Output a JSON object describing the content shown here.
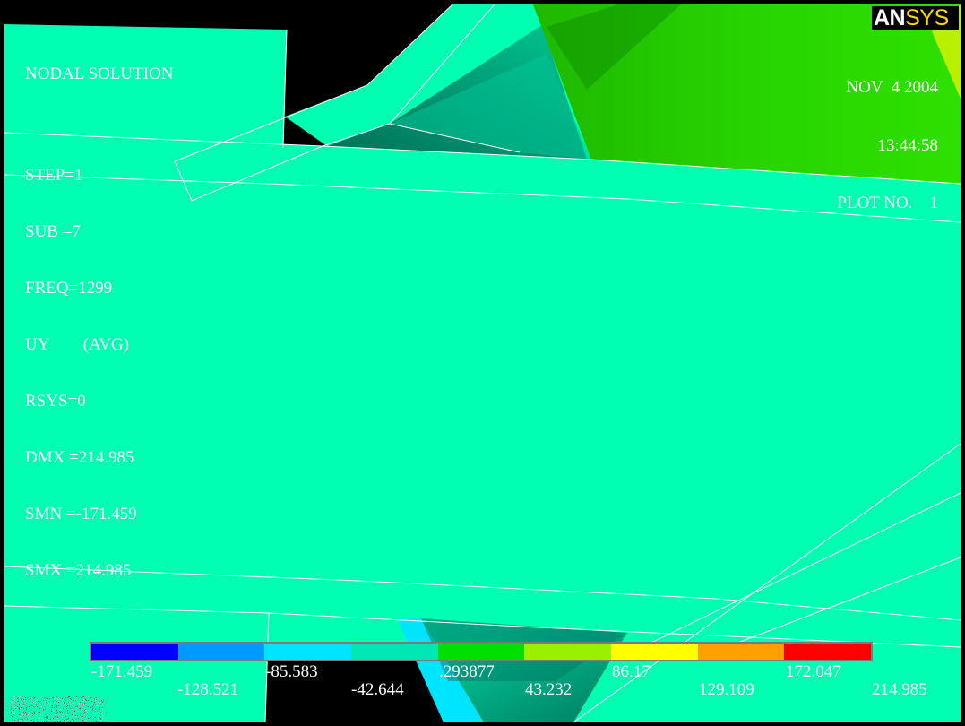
{
  "window": {
    "title": "ANSYS nodal solution plot"
  },
  "logo": {
    "part1": "AN",
    "part2": "SYS"
  },
  "info": {
    "lines": [
      "NODAL SOLUTION",
      "",
      "STEP=1",
      "SUB =7",
      "FREQ=1299",
      "UY        (AVG)",
      "RSYS=0",
      "DMX =214.985",
      "SMN =-171.459",
      "SMX =214.985"
    ]
  },
  "datebox": {
    "date": "NOV  4 2004",
    "time": "13:44:58",
    "plot": "PLOT NO.    1"
  },
  "legend": {
    "colors": [
      "#0000ff",
      "#0099ff",
      "#00e5ff",
      "#00e6b4",
      "#00e000",
      "#99f000",
      "#ffff00",
      "#ffa000",
      "#ff0000"
    ],
    "ticks_top": [
      "-171.459",
      "-85.583",
      ".293877",
      "86.17",
      "172.047"
    ],
    "ticks_bottom": [
      "-128.521",
      "-42.644",
      "43.232",
      "129.109",
      "214.985"
    ]
  },
  "colors": {
    "background": "#000000",
    "model_fill": "#00ffb0",
    "high_region": "#22dd00",
    "edge_lines": "#ffffff"
  }
}
